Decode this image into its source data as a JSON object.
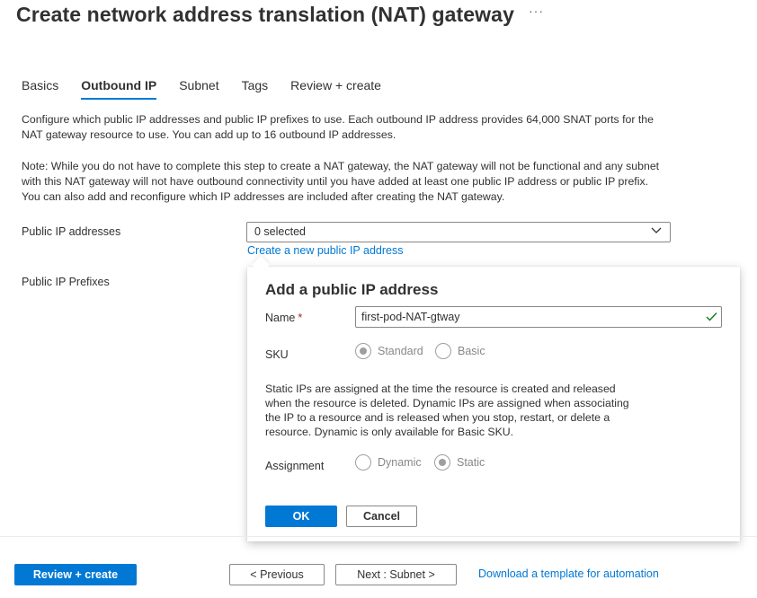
{
  "page": {
    "title": "Create network address translation (NAT) gateway",
    "more_label": "···"
  },
  "tabs": [
    {
      "label": "Basics",
      "active": false
    },
    {
      "label": "Outbound IP",
      "active": true
    },
    {
      "label": "Subnet",
      "active": false
    },
    {
      "label": "Tags",
      "active": false
    },
    {
      "label": "Review + create",
      "active": false
    }
  ],
  "intro": {
    "paragraph1": "Configure which public IP addresses and public IP prefixes to use. Each outbound IP address provides 64,000 SNAT ports for the NAT gateway resource to use. You can add up to 16 outbound IP addresses.",
    "paragraph2": "Note: While you do not have to complete this step to create a NAT gateway, the NAT gateway will not be functional and any subnet with this NAT gateway will not have outbound connectivity until you have added at least one public IP address or public IP prefix. You can also add and reconfigure which IP addresses are included after creating the NAT gateway."
  },
  "fields": {
    "public_ip_label": "Public IP addresses",
    "public_ip_value": "0 selected",
    "create_link": "Create a new public IP address",
    "public_prefixes_label": "Public IP Prefixes"
  },
  "callout": {
    "title": "Add a public IP address",
    "name_label": "Name",
    "required_mark": "*",
    "name_value": "first-pod-NAT-gtway",
    "sku_label": "SKU",
    "sku_options": [
      {
        "label": "Standard",
        "selected": true
      },
      {
        "label": "Basic",
        "selected": false
      }
    ],
    "info": "Static IPs are assigned at the time the resource is created and released when the resource is deleted. Dynamic IPs are assigned when associating the IP to a resource and is released when you stop, restart, or delete a resource. Dynamic is only available for Basic SKU.",
    "assignment_label": "Assignment",
    "assignment_options": [
      {
        "label": "Dynamic",
        "selected": false
      },
      {
        "label": "Static",
        "selected": true
      }
    ],
    "ok_label": "OK",
    "cancel_label": "Cancel"
  },
  "footer": {
    "review_label": "Review + create",
    "previous_label": "< Previous",
    "next_label": "Next : Subnet >",
    "download_label": "Download a template for automation"
  },
  "colors": {
    "accent": "#0078d4",
    "text": "#323130",
    "required": "#a4262c",
    "success": "#107c10"
  }
}
